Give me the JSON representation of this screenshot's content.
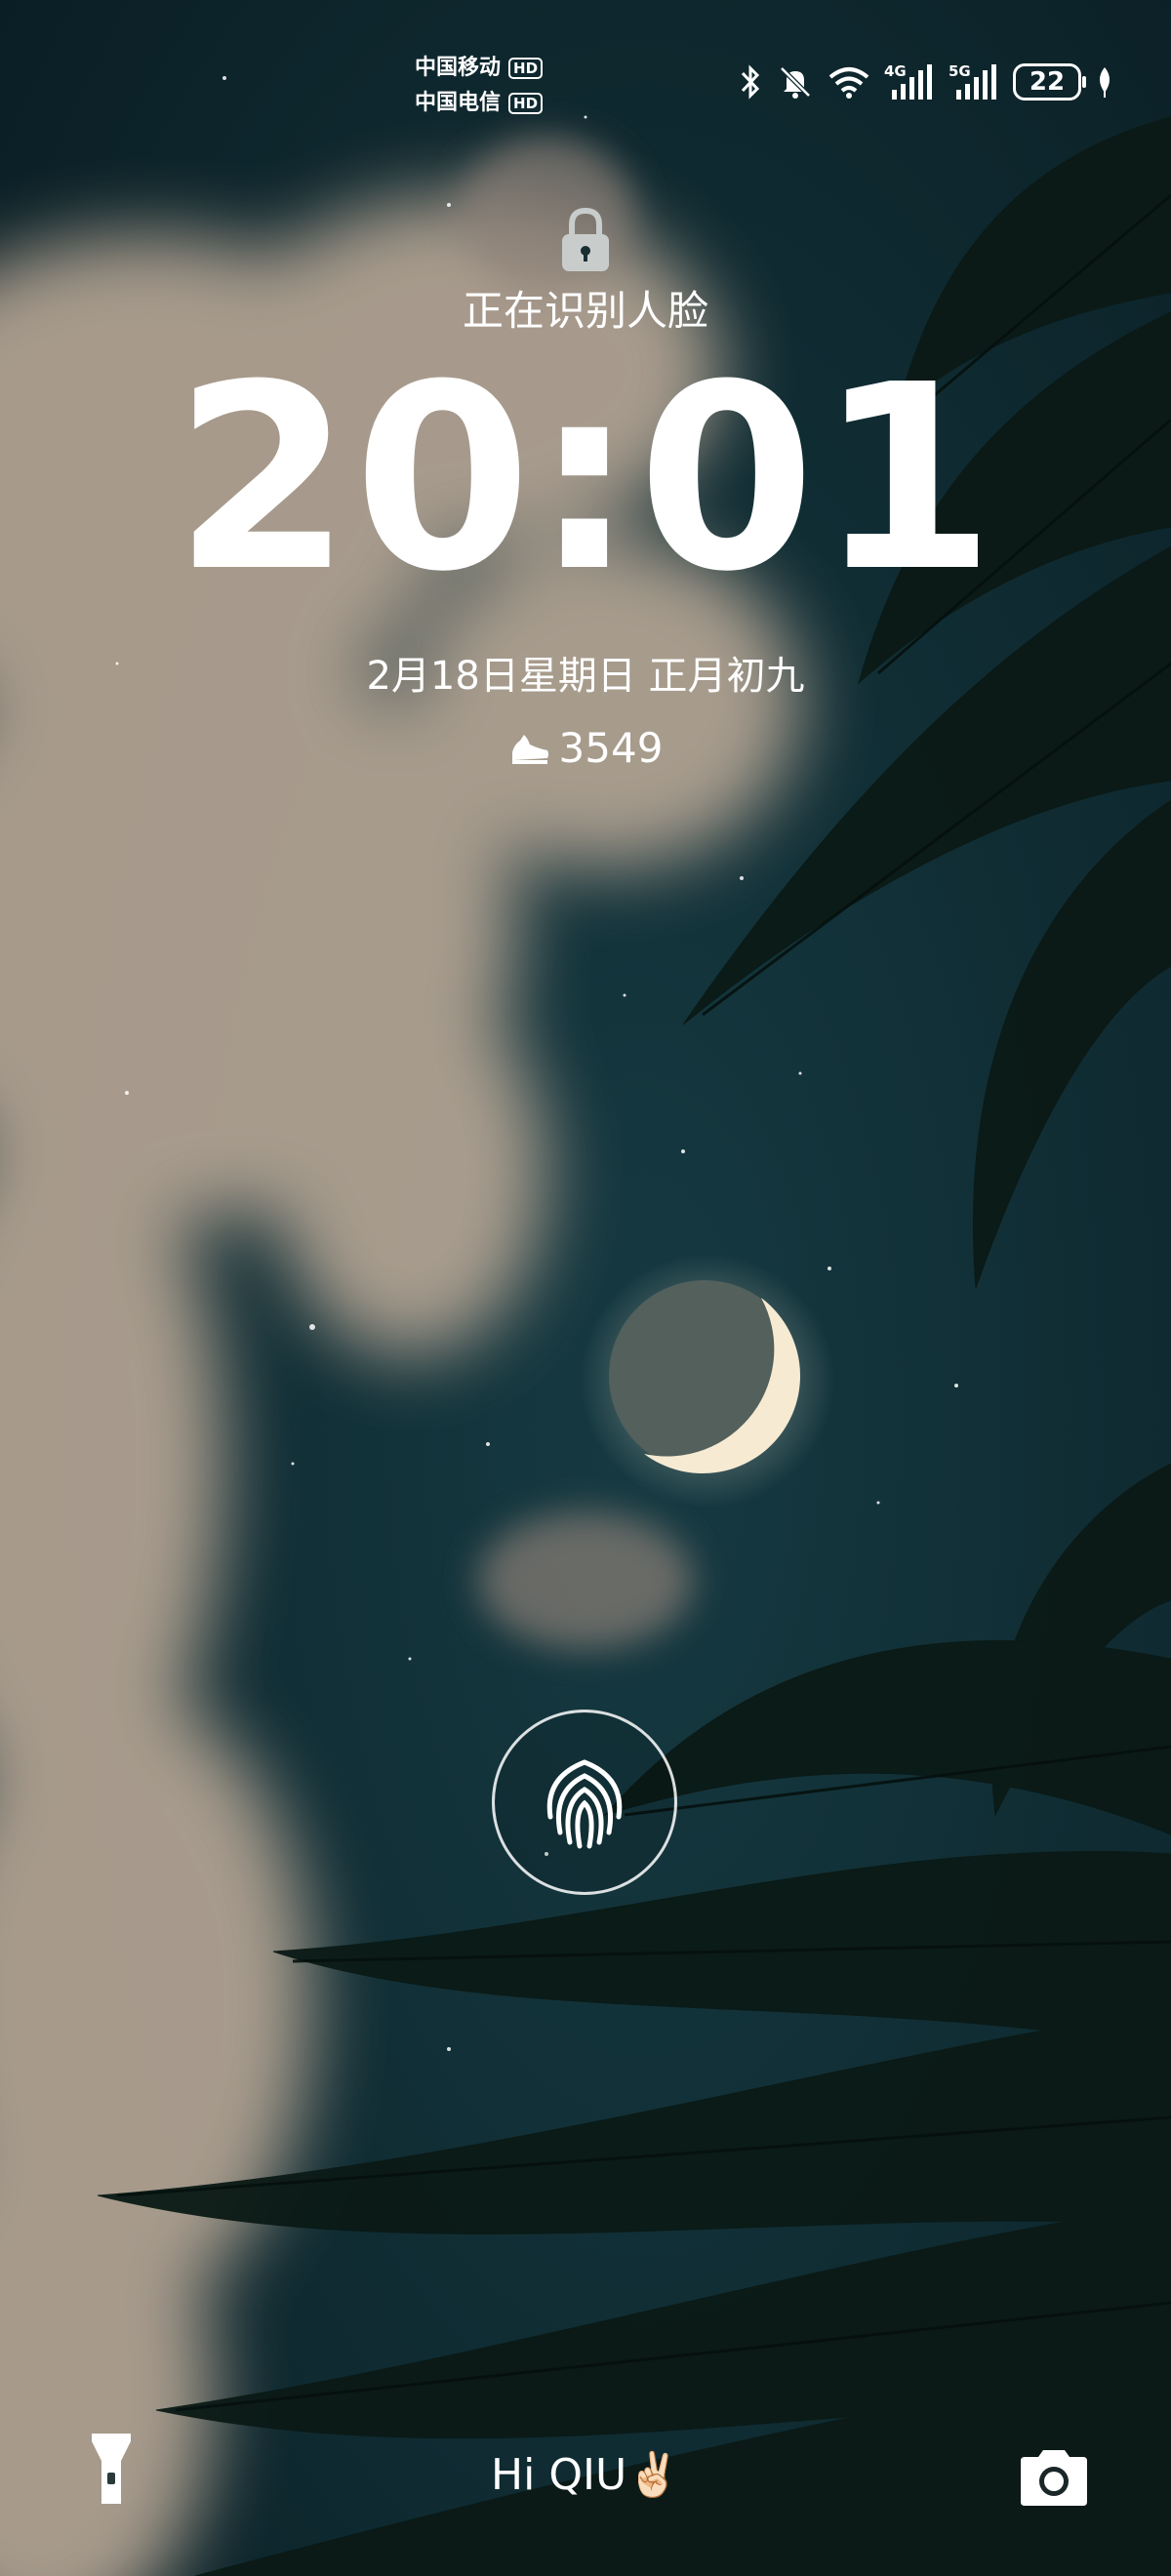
{
  "status_bar": {
    "carrier_1": "中国移动",
    "carrier_2": "中国电信",
    "hd_label": "HD",
    "network_1": "4G",
    "network_2": "5G",
    "battery_level": "22",
    "icons": [
      "bluetooth-icon",
      "mute-icon",
      "wifi-icon",
      "signal-icon",
      "signal-icon",
      "battery-icon",
      "leaf-icon"
    ]
  },
  "lock_screen": {
    "face_status": "正在识别人脸",
    "time": "20:01",
    "date": "2月18日星期日  正月初九",
    "steps": "3549"
  },
  "bottom": {
    "greeting": "Hi QIU✌🏻"
  },
  "colors": {
    "sky": "#0f2a30",
    "text": "#ffffff"
  }
}
